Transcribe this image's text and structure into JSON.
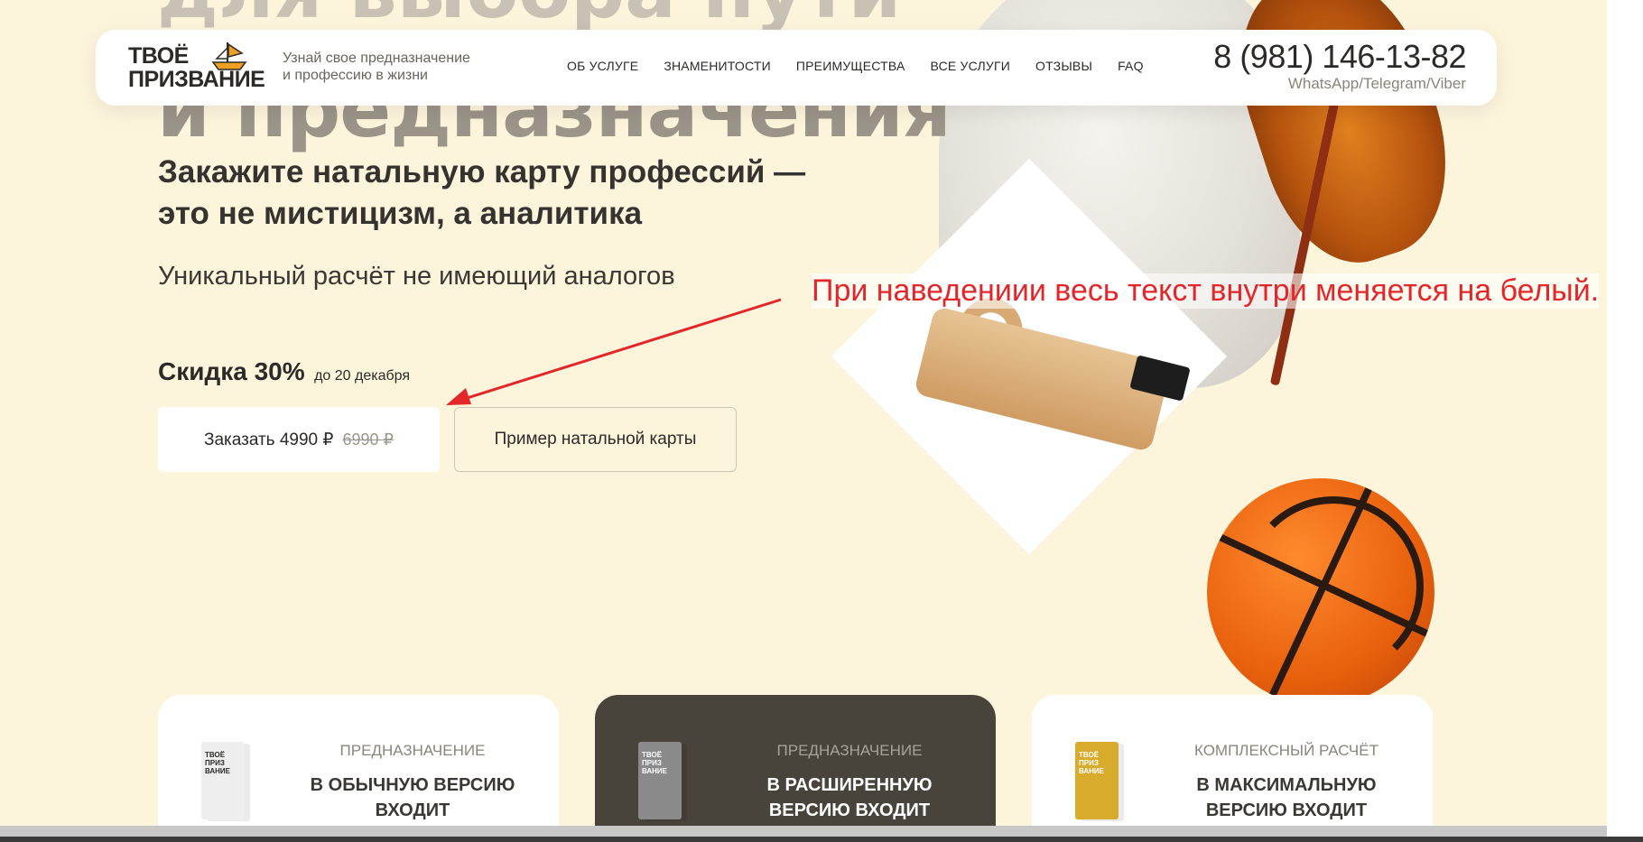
{
  "hero": {
    "bg_title_top": "для выбора пути",
    "bg_title": "и предназначения",
    "subtitle_line1": "Закажите натальную карту профессий —",
    "subtitle_line2": "это не мистицизм, а аналитика",
    "lead": "Уникальный расчёт не имеющий аналогов",
    "discount_main": "Скидка 30%",
    "discount_note": "до 20 декабря",
    "order_button": {
      "label": "Заказать 4990 ₽",
      "old_price": "6990 ₽"
    },
    "example_button": "Пример натальной карты"
  },
  "header": {
    "logo_line1": "ТВОЁ",
    "logo_line2": "ПРИЗВАНИЕ",
    "tagline_line1": "Узнай свое предназначение",
    "tagline_line2": "и профессию в жизни",
    "nav": [
      {
        "label": "ОБ УСЛУГЕ"
      },
      {
        "label": "ЗНАМЕНИТОСТИ"
      },
      {
        "label": "ПРЕИМУЩЕСТВА"
      },
      {
        "label": "ВСЕ УСЛУГИ"
      },
      {
        "label": "ОТЗЫВЫ"
      },
      {
        "label": "FAQ"
      }
    ],
    "phone": "8 (981) 146-13-82",
    "phone_sub": "WhatsApp/Telegram/Viber"
  },
  "annotation": {
    "text": "При наведениии весь текст внутри меняется на белый."
  },
  "cards": [
    {
      "kicker": "ПРЕДНАЗНАЧЕНИЕ",
      "title_line1": "В ОБЫЧНУЮ ВЕРСИЮ",
      "title_line2": "ВХОДИТ",
      "book_label": "ТВОЁ ПРИЗ ВАНИЕ",
      "book_color": "#eeeeee",
      "theme": "light"
    },
    {
      "kicker": "ПРЕДНАЗНАЧЕНИЕ",
      "title_line1": "В РАСШИРЕННУЮ",
      "title_line2": "ВЕРСИЮ ВХОДИТ",
      "book_label": "ТВОЁ ПРИЗ ВАНИЕ",
      "book_color": "#8a8a8a",
      "theme": "dark"
    },
    {
      "kicker": "КОМПЛЕКСНЫЙ РАСЧЁТ",
      "title_line1": "В МАКСИМАЛЬНУЮ",
      "title_line2": "ВЕРСИЮ ВХОДИТ",
      "book_label": "ТВОЁ ПРИЗ ВАНИЕ",
      "book_color": "#d9ab2c",
      "theme": "light"
    }
  ],
  "colors": {
    "page_bg": "#fdf4dc",
    "accent_text": "#2b2a28",
    "dark_card": "#48443b",
    "annotation": "#e3262a"
  }
}
